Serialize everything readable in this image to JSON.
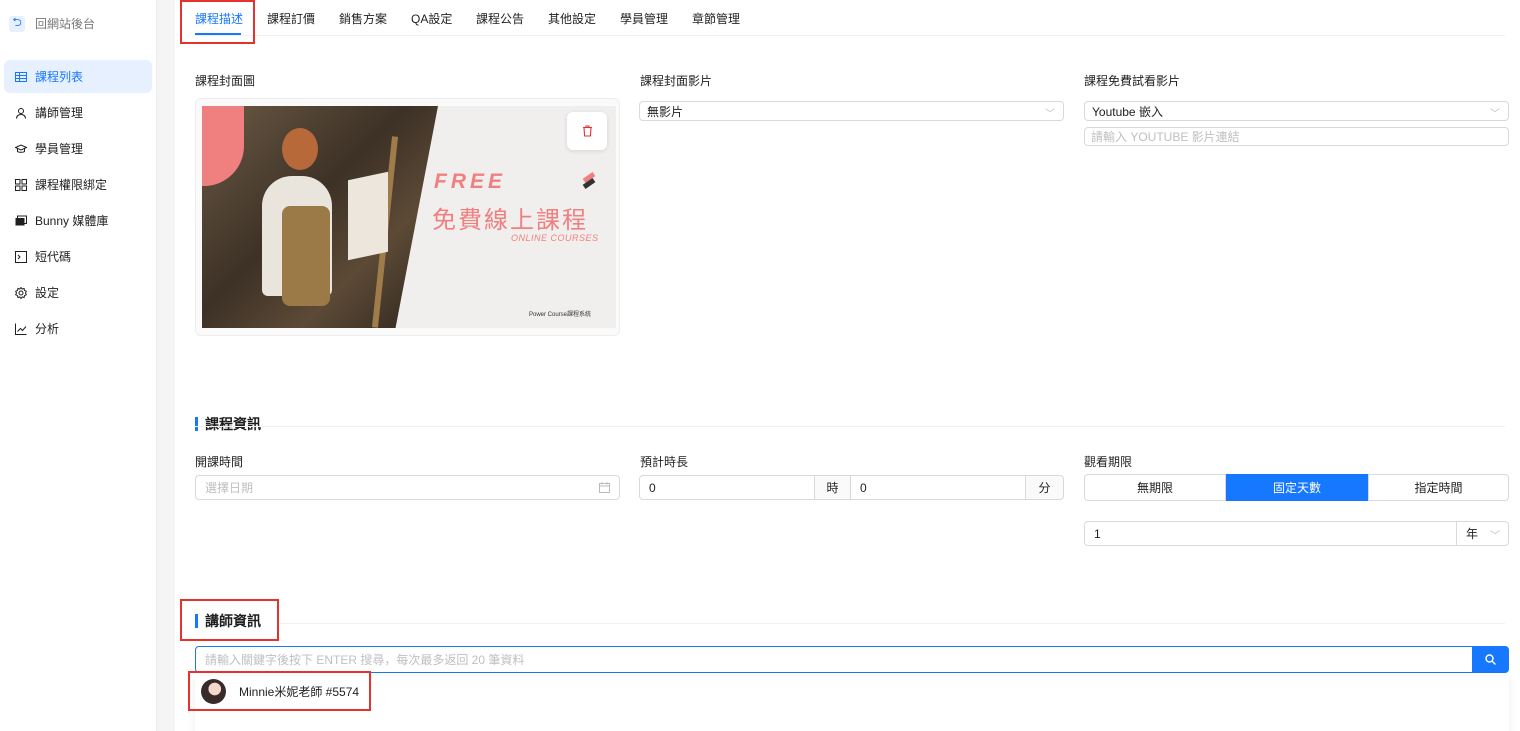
{
  "sidebar": {
    "back_label": "回網站後台",
    "items": [
      {
        "label": "課程列表",
        "icon": "table-icon",
        "active": true
      },
      {
        "label": "講師管理",
        "icon": "user-icon",
        "active": false
      },
      {
        "label": "學員管理",
        "icon": "graduation-cap-icon",
        "active": false
      },
      {
        "label": "課程權限綁定",
        "icon": "apps-icon",
        "active": false
      },
      {
        "label": "Bunny 媒體庫",
        "icon": "media-library-icon",
        "active": false
      },
      {
        "label": "短代碼",
        "icon": "code-icon",
        "active": false
      },
      {
        "label": "設定",
        "icon": "gear-icon",
        "active": false
      },
      {
        "label": "分析",
        "icon": "line-chart-icon",
        "active": false
      }
    ]
  },
  "tabs": [
    {
      "label": "課程描述",
      "active": true
    },
    {
      "label": "課程訂價",
      "active": false
    },
    {
      "label": "銷售方案",
      "active": false
    },
    {
      "label": "QA設定",
      "active": false
    },
    {
      "label": "課程公告",
      "active": false
    },
    {
      "label": "其他設定",
      "active": false
    },
    {
      "label": "學員管理",
      "active": false
    },
    {
      "label": "章節管理",
      "active": false
    }
  ],
  "media": {
    "cover_image_label": "課程封面圖",
    "cover_image": {
      "title_en": "FREE",
      "title_cn": "免費線上課程",
      "subtitle": "ONLINE COURSES",
      "footer": "Power Course課程系統"
    },
    "cover_video_label": "課程封面影片",
    "cover_video_value": "無影片",
    "trial_video_label": "課程免費試看影片",
    "trial_video_value": "Youtube 嵌入",
    "trial_video_url_placeholder": "請輸入 YOUTUBE 影片連結"
  },
  "course_info": {
    "title": "課程資訊",
    "start_time_label": "開課時間",
    "start_time_placeholder": "選擇日期",
    "duration_label": "預計時長",
    "hours_value": "0",
    "hours_unit": "時",
    "minutes_value": "0",
    "minutes_unit": "分",
    "access_label": "觀看期限",
    "access_options": [
      "無期限",
      "固定天數",
      "指定時間"
    ],
    "access_selected": "固定天數",
    "access_amount": "1",
    "access_unit": "年"
  },
  "teacher_info": {
    "title": "講師資訊",
    "search_placeholder": "請輸入關鍵字後按下 ENTER 搜尋，每次最多返回 20 筆資料",
    "results": [
      {
        "name": "Minnie米妮老師 #5574"
      }
    ]
  },
  "colors": {
    "accent": "#1677ff",
    "highlight_box": "#e5322d",
    "cover_pink": "#f08080"
  }
}
